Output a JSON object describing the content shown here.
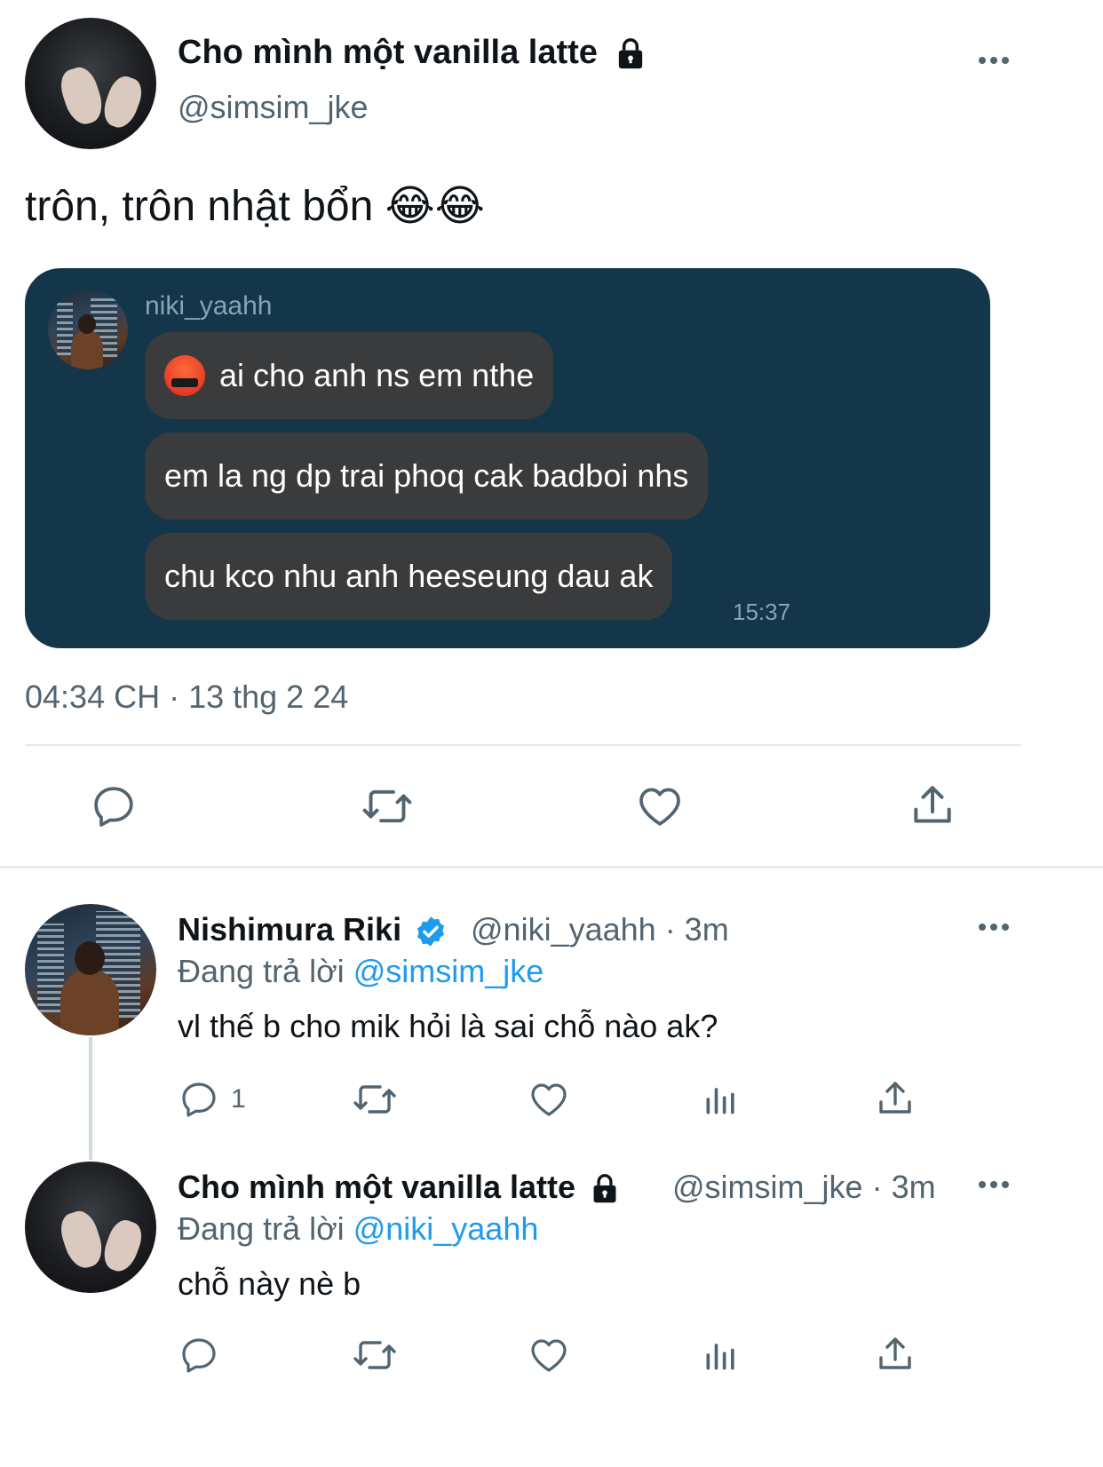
{
  "main_tweet": {
    "display_name": "Cho mình một vanilla latte",
    "handle": "@simsim_jke",
    "text": "trôn, trôn nhật bổn 😂😂",
    "timestamp": "04:34 CH · 13 thg 2 24"
  },
  "chat_image": {
    "sender": "niki_yaahh",
    "messages": [
      "ai cho anh ns em nthe",
      "em la ng dp trai phoq cak badboi nhs",
      "chu kco nhu anh heeseung dau ak"
    ],
    "time": "15:37"
  },
  "replies": [
    {
      "display_name": "Nishimura Riki",
      "handle": "@niki_yaahh",
      "age": "· 3m",
      "replying_prefix": "Đang trả lời",
      "replying_to": "@simsim_jke",
      "text": "vl thế b cho mik hỏi là sai chỗ nào ak?",
      "reply_count": "1"
    },
    {
      "display_name": "Cho mình một vanilla latte",
      "handle": "@simsim_jke",
      "age": "· 3m",
      "replying_prefix": "Đang trả lời",
      "replying_to": "@niki_yaahh",
      "text": "chỗ này nè b"
    }
  ],
  "colors": {
    "accent": "#1d9bf0",
    "muted": "#536471",
    "chat_bg": "#13364a",
    "bubble": "#3a3b3d"
  },
  "icons": [
    "lock-icon",
    "more-icon",
    "reply-icon",
    "retweet-icon",
    "like-icon",
    "share-icon",
    "views-icon",
    "verified-badge-icon"
  ]
}
